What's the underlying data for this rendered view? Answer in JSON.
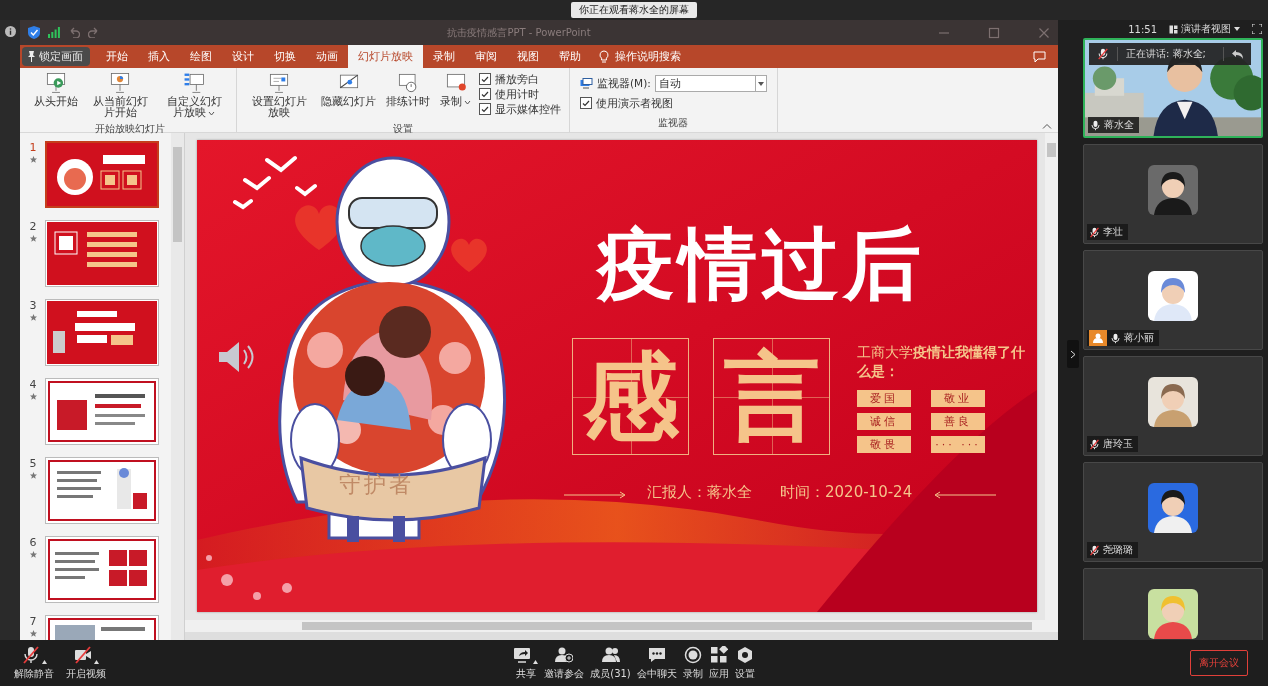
{
  "meeting_banner": {
    "text": "你正在观看蒋水全的屏幕"
  },
  "powerpoint": {
    "title": "抗击疫情感言PPT - PowerPoint",
    "lock_button": "锁定画面",
    "tabs": [
      {
        "label": "开始",
        "selected": false
      },
      {
        "label": "插入",
        "selected": false
      },
      {
        "label": "绘图",
        "selected": false
      },
      {
        "label": "设计",
        "selected": false
      },
      {
        "label": "切换",
        "selected": false
      },
      {
        "label": "动画",
        "selected": false
      },
      {
        "label": "幻灯片放映",
        "selected": true
      },
      {
        "label": "录制",
        "selected": false
      },
      {
        "label": "审阅",
        "selected": false
      },
      {
        "label": "视图",
        "selected": false
      },
      {
        "label": "帮助",
        "selected": false
      }
    ],
    "search": "操作说明搜索",
    "ribbon_groups": [
      {
        "label": "开始放映幻灯片",
        "kind": "row",
        "items": [
          {
            "kind": "button",
            "label": "从头开始"
          },
          {
            "kind": "button",
            "label": "从当前幻灯片开始"
          },
          {
            "kind": "menu_button",
            "label": "自定义幻灯片放映"
          }
        ]
      },
      {
        "label": "设置",
        "kind": "row",
        "items": [
          {
            "kind": "button",
            "label": "设置幻灯片放映"
          },
          {
            "kind": "button",
            "label": "隐藏幻灯片"
          },
          {
            "kind": "button",
            "label": "排练计时"
          },
          {
            "kind": "menu_button",
            "label": "录制"
          },
          {
            "kind": "checks",
            "options": [
              {
                "label": "播放旁白",
                "checked": true
              },
              {
                "label": "使用计时",
                "checked": true
              },
              {
                "label": "显示媒体控件",
                "checked": true
              }
            ]
          }
        ]
      },
      {
        "label": "监视器",
        "kind": "stack",
        "items": [
          {
            "kind": "dropdown",
            "label": "监视器(M):",
            "value": "自动"
          },
          {
            "kind": "checkbox",
            "label": "使用演示者视图",
            "checked": true
          }
        ]
      }
    ]
  },
  "slides": [
    {
      "number": "1",
      "selected": true
    },
    {
      "number": "2",
      "selected": false
    },
    {
      "number": "3",
      "selected": false
    },
    {
      "number": "4",
      "selected": false
    },
    {
      "number": "5",
      "selected": false
    },
    {
      "number": "6",
      "selected": false
    },
    {
      "number": "7",
      "selected": false
    }
  ],
  "slide": {
    "heading": "疫情过后",
    "characters": [
      "感",
      "言"
    ],
    "intro": "工商大学**疫情让我懂得了什么是：**",
    "tags": [
      "爱国",
      "敬业",
      "诚信",
      "善良",
      "敬畏",
      "··· ···"
    ],
    "banner": "守护者",
    "reporter": "汇报人：蒋水全",
    "date": "时间：2020-10-24"
  },
  "meeting_side": {
    "time": "11:51",
    "view_button": "演讲者视图",
    "speaking": {
      "label": "正在讲话: 蒋水全;",
      "muted": true
    },
    "participants": [
      {
        "kind": "video",
        "name": "蒋水全",
        "muted": false,
        "host": false
      },
      {
        "kind": "avatar",
        "name": "李壮",
        "muted": true,
        "host": false
      },
      {
        "kind": "avatar",
        "name": "蒋小丽",
        "muted": false,
        "host": true
      },
      {
        "kind": "avatar",
        "name": "唐玲玉",
        "muted": true,
        "host": false
      },
      {
        "kind": "avatar",
        "name": "尧璐璐",
        "muted": true,
        "host": false
      },
      {
        "kind": "avatar"
      }
    ]
  },
  "toolbar": {
    "left": [
      {
        "label": "解除静音",
        "off": true,
        "menu": true
      },
      {
        "label": "开启视频",
        "off": true,
        "menu": true
      }
    ],
    "center": [
      {
        "label": "共享",
        "menu": true
      },
      {
        "label": "邀请参会",
        "menu": false
      },
      {
        "label": "成员(31)",
        "menu": false
      },
      {
        "label": "会中聊天",
        "menu": false
      },
      {
        "label": "录制",
        "menu": false
      },
      {
        "label": "应用",
        "menu": false
      },
      {
        "label": "设置",
        "menu": false
      }
    ],
    "leave_button": "离开会议"
  }
}
